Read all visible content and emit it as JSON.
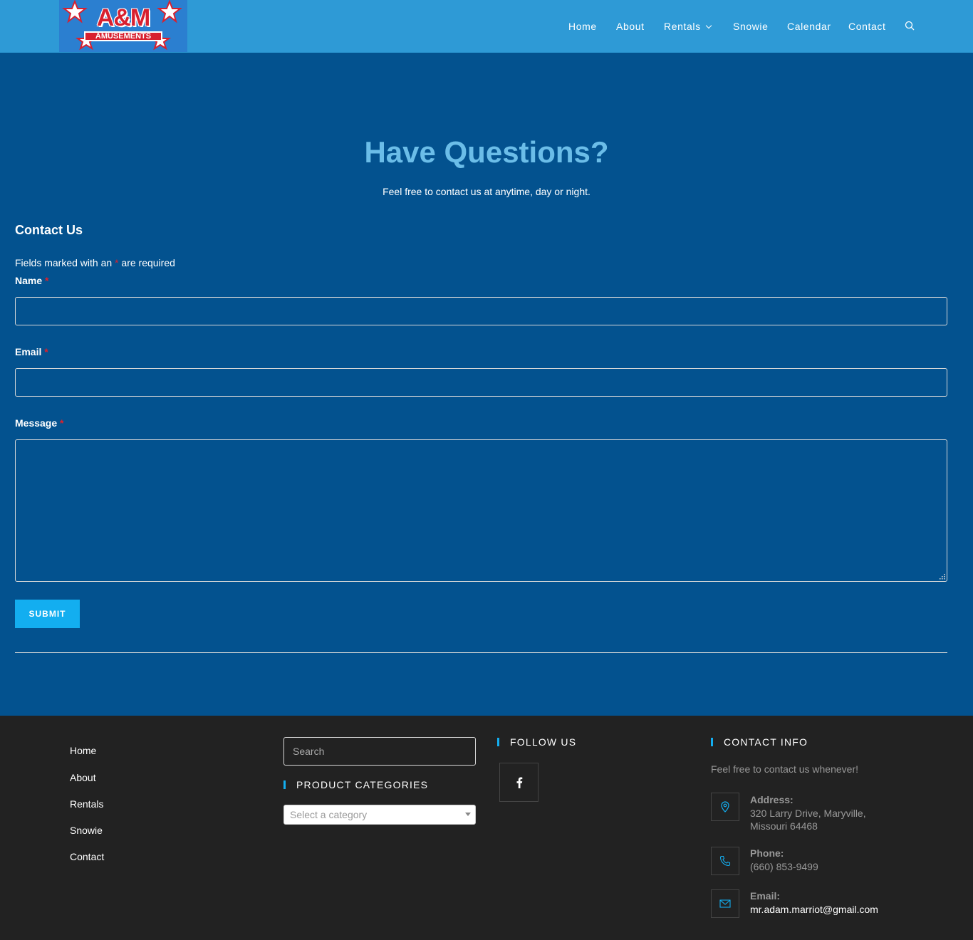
{
  "logo": {
    "main": "A&M",
    "sub": "AMUSEMENTS"
  },
  "nav": {
    "home": "Home",
    "about": "About",
    "rentals": "Rentals",
    "snowie": "Snowie",
    "calendar": "Calendar",
    "contact": "Contact"
  },
  "hero": {
    "title": "Have Questions?",
    "subtitle": "Feel free to contact us at anytime, day or night."
  },
  "form": {
    "title": "Contact Us",
    "note_before": "Fields marked with an ",
    "note_star": "*",
    "note_after": " are required",
    "name_label": "Name",
    "email_label": "Email",
    "message_label": "Message",
    "required_mark": "*",
    "submit": "SUBMIT"
  },
  "footer": {
    "links": [
      "Home",
      "About",
      "Rentals",
      "Snowie",
      "Contact"
    ],
    "search_placeholder": "Search",
    "product_categories_heading": "PRODUCT CATEGORIES",
    "category_select": "Select a category",
    "follow_heading": "FOLLOW US",
    "contact_heading": "CONTACT INFO",
    "contact_desc": "Feel free to contact us whenever!",
    "address_label": "Address:",
    "address_line1": "320 Larry Drive, Maryville,",
    "address_line2": "Missouri 64468",
    "phone_label": "Phone:",
    "phone": "(660) 853-9499",
    "email_label": "Email:",
    "email": "mr.adam.marriot@gmail.com"
  },
  "colors": {
    "header_bg": "#2e9ad6",
    "page_bg": "#03528f",
    "hero_title": "#6bbde8",
    "accent": "#13aef0",
    "required": "#e0202a",
    "footer_bg": "#222222"
  },
  "icons": {
    "search": "search-icon",
    "chevron": "chevron-down-icon",
    "facebook": "facebook-icon",
    "location": "map-pin-icon",
    "phone": "phone-icon",
    "email": "envelope-icon"
  }
}
